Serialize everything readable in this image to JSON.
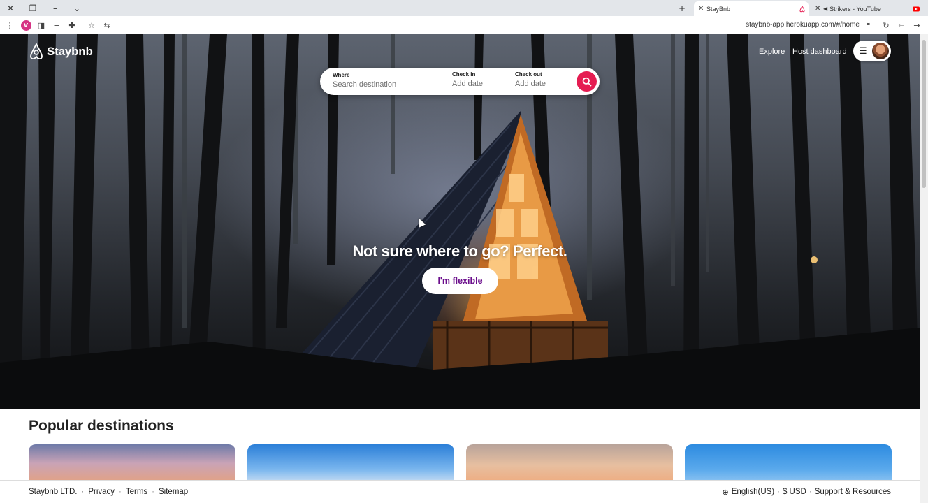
{
  "browser": {
    "tabs": [
      {
        "title": "StayBnb",
        "active": true
      },
      {
        "title": "Strikers - YouTube",
        "active": false
      }
    ],
    "new_tab_icon": "plus-icon",
    "profile_initial": "V",
    "url": "staybnb-app.herokuapp.com/#/home"
  },
  "header": {
    "brand": "Staybnb",
    "nav": {
      "explore": "Explore",
      "host_dashboard": "Host dashboard"
    }
  },
  "search": {
    "where_label": "Where",
    "where_placeholder": "Search destination",
    "checkin_label": "Check in",
    "checkin_value": "Add date",
    "checkout_label": "Check out",
    "checkout_value": "Add date"
  },
  "hero": {
    "headline": "Not sure where to go? Perfect.",
    "cta": "I'm flexible"
  },
  "popular": {
    "title": "Popular destinations"
  },
  "footer": {
    "company": "Staybnb LTD.",
    "privacy": "Privacy",
    "terms": "Terms",
    "sitemap": "Sitemap",
    "language": "English(US)",
    "currency": "$ USD",
    "support": "Support & Resources"
  },
  "colors": {
    "accent": "#e51d52",
    "cta_text": "#6b0e8c"
  }
}
